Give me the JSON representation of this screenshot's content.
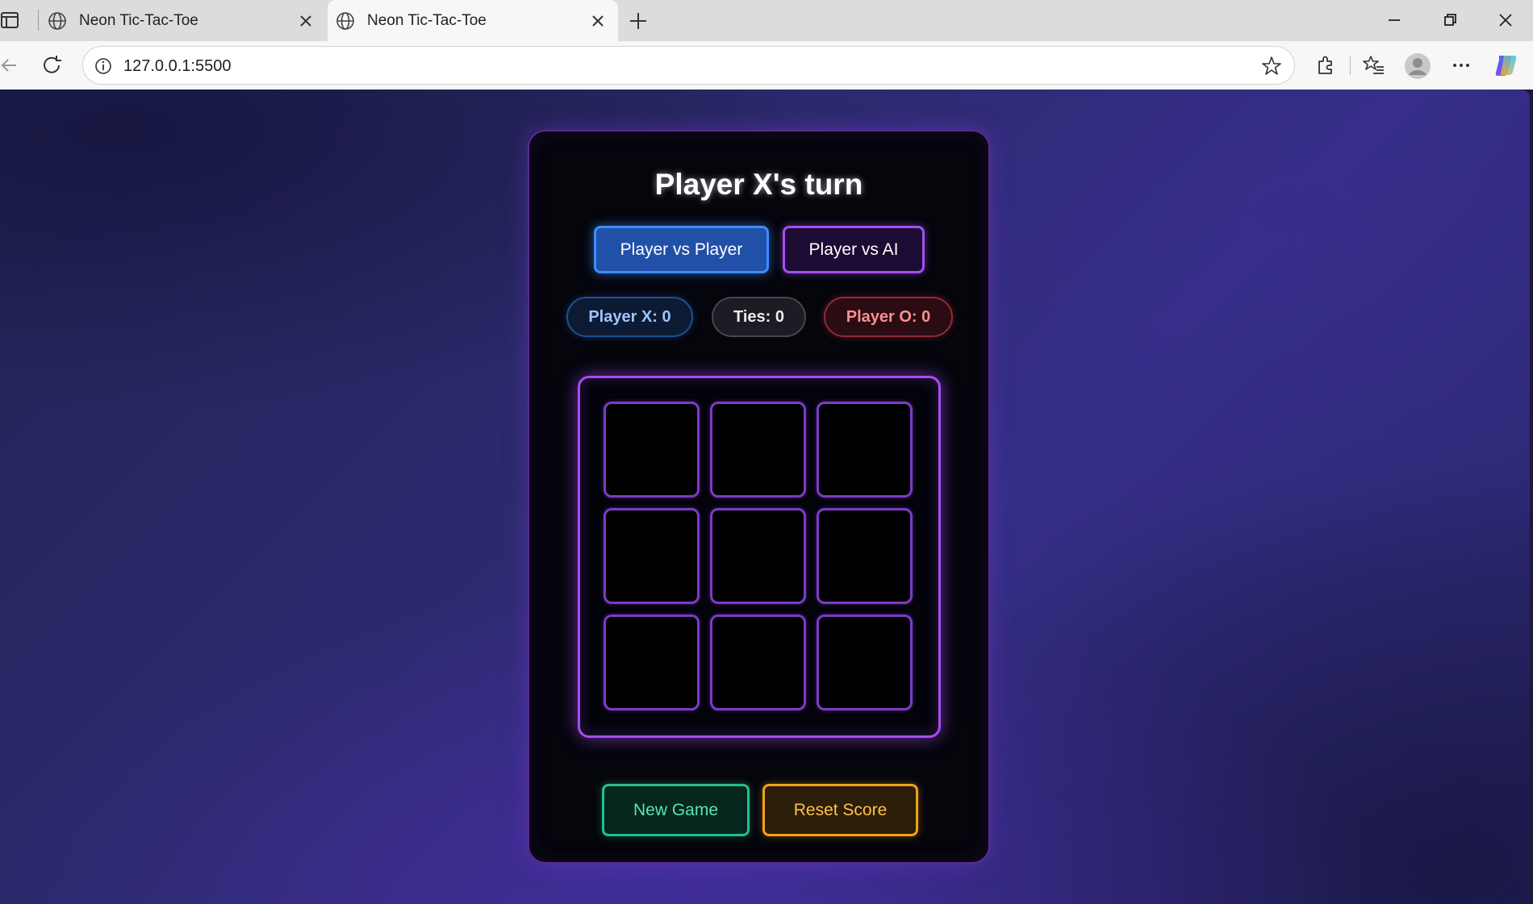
{
  "browser": {
    "tabs": [
      {
        "title": "Neon Tic-Tac-Toe",
        "active": false
      },
      {
        "title": "Neon Tic-Tac-Toe",
        "active": true
      }
    ],
    "address": {
      "url": "127.0.0.1:5500"
    }
  },
  "game": {
    "status": "Player X's turn",
    "modes": {
      "pvp_label": "Player vs Player",
      "ai_label": "Player vs AI",
      "selected": "Player vs Player"
    },
    "scores": {
      "x": "Player X: 0",
      "ties": "Ties: 0",
      "o": "Player O: 0"
    },
    "board": [
      "",
      "",
      "",
      "",
      "",
      "",
      "",
      "",
      ""
    ],
    "actions": {
      "new_game": "New Game",
      "reset_score": "Reset Score"
    }
  },
  "colors": {
    "accent_purple": "#a64df5",
    "player_x_blue": "#3d8cff",
    "player_o_red": "#ff8f8f",
    "new_game_green": "#23c08a",
    "reset_orange": "#f0a21f"
  }
}
